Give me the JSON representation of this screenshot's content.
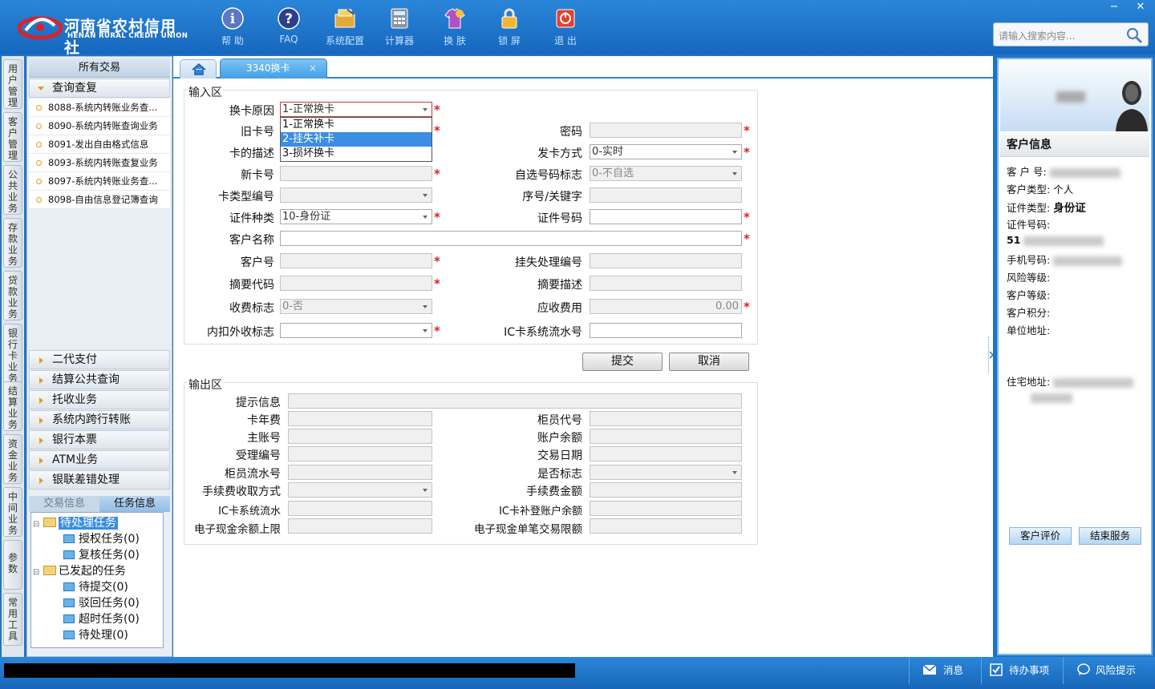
{
  "header": {
    "logo_cn": "河南省农村信用社",
    "logo_en": "HENAN RURAL CREDIT UNION",
    "toolbar": [
      {
        "label": "帮 助",
        "icon": "help-icon"
      },
      {
        "label": "FAQ",
        "icon": "faq-icon"
      },
      {
        "label": "系统配置",
        "icon": "system-config-icon"
      },
      {
        "label": "计算器",
        "icon": "calculator-icon"
      },
      {
        "label": "换 肤",
        "icon": "skin-icon"
      },
      {
        "label": "锁 屏",
        "icon": "lock-icon"
      },
      {
        "label": "退 出",
        "icon": "power-icon"
      }
    ],
    "search_placeholder": "请输入搜索内容...",
    "window_controls": [
      "−",
      "✕"
    ]
  },
  "vertical_tabs": [
    "用户管理",
    "客户管理",
    "公共业务",
    "存款业务",
    "贷款业务",
    "银行卡业务",
    "结算业务",
    "资金业务",
    "中间业务",
    "参数",
    "常用工具"
  ],
  "left_nav": {
    "title": "所有交易",
    "open_category": "查询查复",
    "items": [
      "8088-系统内转账业务查...",
      "8090-系统内转账查询业务",
      "8091-发出自由格式信息",
      "8093-系统内转账查复业务",
      "8097-系统内转账业务查...",
      "8098-自由信息登记簿查询"
    ],
    "categories": [
      "二代支付",
      "结算公共查询",
      "托收业务",
      "系统内跨行转账",
      "银行本票",
      "ATM业务",
      "银联差错处理"
    ],
    "task_tabs": [
      "交易信息",
      "任务信息"
    ],
    "tree": [
      {
        "label": "待处理任务",
        "level": 0,
        "selected": true
      },
      {
        "label": "授权任务(0)",
        "level": 1
      },
      {
        "label": "复核任务(0)",
        "level": 1
      },
      {
        "label": "已发起的任务",
        "level": 0
      },
      {
        "label": "待提交(0)",
        "level": 1
      },
      {
        "label": "驳回任务(0)",
        "level": 1
      },
      {
        "label": "超时任务(0)",
        "level": 1
      },
      {
        "label": "待处理(0)",
        "level": 1
      }
    ]
  },
  "content": {
    "tab": "3340换卡",
    "tab_close": "×",
    "input_title": "输入区",
    "output_title": "输出区",
    "fields": {
      "reason_label": "换卡原因",
      "reason_value": "1-正常换卡",
      "oldcard_label": "旧卡号",
      "password_label": "密码",
      "desc_label": "卡的描述",
      "issue_label": "发卡方式",
      "issue_value": "0-实时",
      "newcard_label": "新卡号",
      "optional_label": "自选号码标志",
      "optional_value": "0-不自选",
      "cardtype_label": "卡类型编号",
      "seq_label": "序号/关键字",
      "idtype_label": "证件种类",
      "idtype_value": "10-身份证",
      "idno_label": "证件号码",
      "custname_label": "客户名称",
      "custno_label": "客户号",
      "lossno_label": "挂失处理编号",
      "abscode_label": "摘要代码",
      "absdesc_label": "摘要描述",
      "feeflag_label": "收费标志",
      "feeflag_value": "0-否",
      "fee_label": "应收费用",
      "fee_value": "0.00",
      "inout_label": "内扣外收标志",
      "icflow_label": "IC卡系统流水号"
    },
    "dropdown_options": [
      "1-正常换卡",
      "2-挂失补卡",
      "3-损坏换卡"
    ],
    "dropdown_selected": 1,
    "submit": "提交",
    "cancel": "取消",
    "output": {
      "hint": "提示信息",
      "annualfee": "卡年费",
      "teller": "柜员代号",
      "mainacct": "主账号",
      "balance": "账户余额",
      "acceptno": "受理编号",
      "txdate": "交易日期",
      "tellerflow": "柜员流水号",
      "yesno": "是否标志",
      "feemode": "手续费收取方式",
      "feeamt": "手续费金额",
      "icflow": "IC卡系统流水",
      "icsupbal": "IC卡补登账户余额",
      "ecashmax": "电子现金余额上限",
      "ecashsingle": "电子现金单笔交易限额"
    }
  },
  "customer": {
    "title": "客户信息",
    "name_masked": "李X",
    "custno_label": "客 户 号:",
    "custtype_label": "客户类型:",
    "custtype_value": "个人",
    "idtype_label": "证件类型:",
    "idtype_value": "身份证",
    "idno_label": "证件号码:",
    "idno_prefix": "51",
    "phone_label": "手机号码:",
    "risk_label": "风险等级:",
    "level_label": "客户等级:",
    "points_label": "客户积分:",
    "unit_label": "单位地址:",
    "home_label": "住宅地址:",
    "eval_button": "客户评价",
    "end_button": "结束服务"
  },
  "statusbar": {
    "message": "消息",
    "todo": "待办事项",
    "risk": "风险提示"
  }
}
